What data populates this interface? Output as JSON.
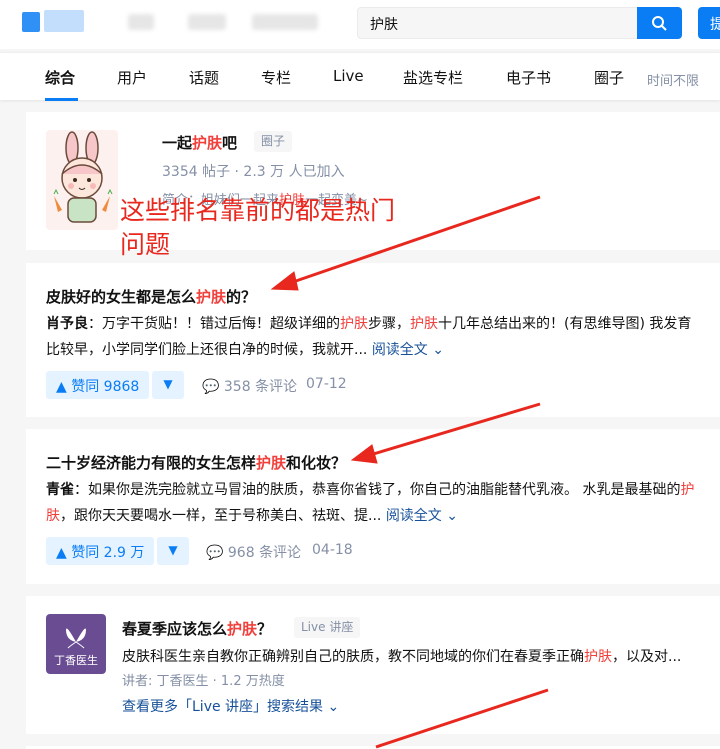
{
  "header": {
    "search_value": "护肤",
    "ask_label": "提"
  },
  "tabs": [
    {
      "label": "综合",
      "active": true
    },
    {
      "label": "用户"
    },
    {
      "label": "话题"
    },
    {
      "label": "专栏"
    },
    {
      "label": "Live"
    },
    {
      "label": "盐选专栏"
    },
    {
      "label": "电子书"
    },
    {
      "label": "圈子"
    }
  ],
  "time_filter": "时间不限",
  "circle": {
    "title_pre": "一起",
    "title_hl": "护肤",
    "title_post": "吧",
    "tag": "圈子",
    "stats": "3354 帖子 · 2.3 万 人已加入",
    "desc_pre": "简介：姐妹们一起来",
    "desc_hl": "护肤",
    "desc_post": "一起变美~"
  },
  "annotation": {
    "line1": "这些排名靠前的都是热门",
    "line2": "问题"
  },
  "answers": [
    {
      "title_pre": "皮肤好的女生都是怎么",
      "title_hl": "护肤",
      "title_post": "的？",
      "author": "肖予良",
      "text_1": "：万字干货贴！！错过后悔！超级详细的",
      "hl_1": "护肤",
      "text_2": "步骤，",
      "hl_2": "护肤",
      "text_3": "十几年总结出来的！(有思维导图) 我发育比较早，小学同学们脸上还很白净的时候，我就开... ",
      "read_more": "阅读全文",
      "votes": "赞同 9868",
      "comments": "358 条评论",
      "date": "07-12"
    },
    {
      "title_pre": "二十岁经济能力有限的女生怎样",
      "title_hl": "护肤",
      "title_post": "和化妆？",
      "author": "青雀",
      "text_1": "：如果你是洗完脸就立马冒油的肤质，恭喜你省钱了，你自己的油脂能替代乳液。 水乳是最基础的",
      "hl_1": "护肤",
      "text_2": "，跟你天天要喝水一样，至于号称美白、祛斑、提... ",
      "read_more": "阅读全文",
      "votes": "赞同 2.9 万",
      "comments": "968 条评论",
      "date": "04-18"
    }
  ],
  "live": {
    "logo_text": "丁香医生",
    "title_pre": "春夏季应该怎么",
    "title_hl": "护肤",
    "title_post": "？",
    "tag": "Live 讲座",
    "desc_pre": "皮肤科医生亲自教你正确辨别自己的肤质，教不同地域的你们在春夏季正确",
    "desc_hl": "护肤",
    "desc_post": "，以及对...",
    "meta": "讲者: 丁香医生 · 1.2 万热度",
    "more": "查看更多「Live 讲座」搜索结果"
  },
  "colors": {
    "accent": "#0a7df5",
    "highlight": "#f1403c",
    "annotation": "#e8281e"
  }
}
